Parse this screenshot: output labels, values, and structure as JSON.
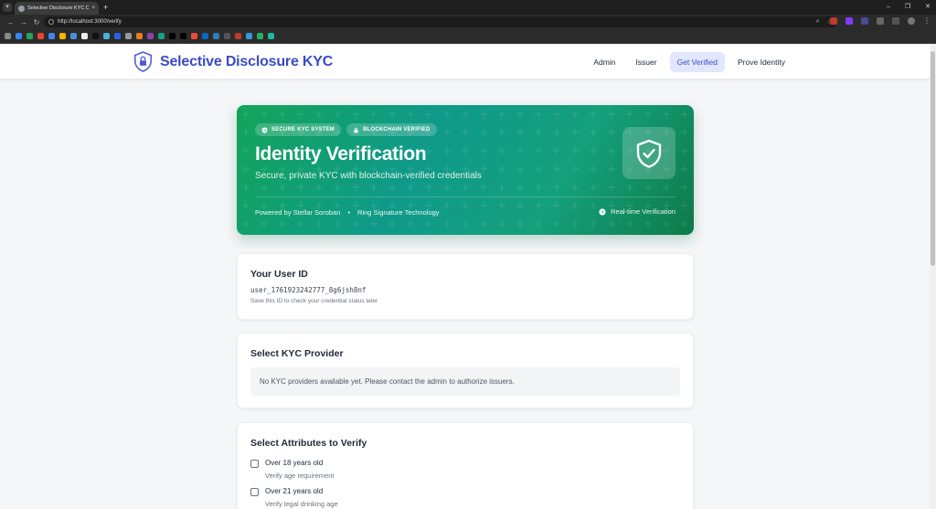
{
  "browser": {
    "tab_title": "Selective Disclosure KYC Demo",
    "tab_close": "×",
    "new_tab": "+",
    "url": "http://localhost:3000/verify"
  },
  "navbar": {
    "brand": "Selective Disclosure KYC",
    "links": [
      "Admin",
      "Issuer",
      "Get Verified",
      "Prove Identity"
    ],
    "active_link": "Get Verified"
  },
  "hero": {
    "badges": [
      "SECURE KYC SYSTEM",
      "BLOCKCHAIN VERIFIED"
    ],
    "title": "Identity Verification",
    "subtitle": "Secure, private KYC with blockchain-verified credentials",
    "footer_left": "Powered by Stellar Soroban",
    "footer_separator": "•",
    "footer_middle": "Ring Signature Technology",
    "footer_right": "Real-time Verification",
    "icon": "shield-check-icon"
  },
  "user_id_card": {
    "title": "Your User ID",
    "user_id": "user_1761923242777_8g6jsh8nf",
    "hint": "Save this ID to check your credential status later"
  },
  "provider_card": {
    "title": "Select KYC Provider",
    "notice": "No KYC providers available yet. Please contact the admin to authorize issuers."
  },
  "attributes_card": {
    "title": "Select Attributes to Verify",
    "items": [
      {
        "label": "Over 18 years old",
        "description": "Verify age requirement",
        "checked": false
      },
      {
        "label": "Over 21 years old",
        "description": "Verify legal drinking age",
        "checked": false
      }
    ]
  },
  "colors": {
    "brand": "#3b4bc4",
    "hero_start": "#12a45a",
    "hero_end": "#0e7a4a",
    "active_nav_bg": "#e0e7ff"
  }
}
